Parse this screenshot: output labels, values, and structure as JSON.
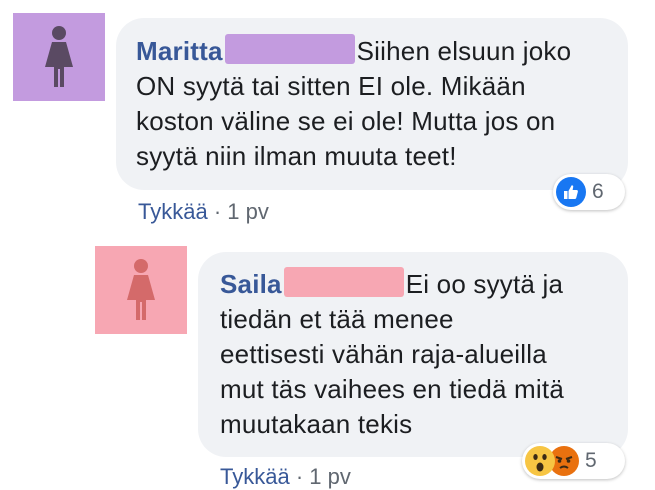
{
  "comments": [
    {
      "author": "Maritta",
      "text_lines": [
        "Siihen elsuun joko",
        "ON syytä tai sitten EI ole. Mikään",
        "koston väline se ei ole! Mutta jos on",
        "syytä niin ilman muuta teet!"
      ],
      "avatar_color": "#c39bdf",
      "avatar_figure_color": "#5a4a63",
      "redaction_color": "#c39bdf",
      "like_label": "Tykkää",
      "separator": "·",
      "time": "1 pv",
      "reactions": [
        "like-icon"
      ],
      "reaction_count": "6"
    },
    {
      "author": "Saila",
      "text_lines": [
        "Ei oo syytä ja",
        "tiedän et tää menee",
        "eettisesti vähän raja-alueilla",
        "mut täs vaihees en tiedä mitä",
        "muutakaan tekis"
      ],
      "avatar_color": "#f7a7b3",
      "avatar_figure_color": "#d46a6a",
      "redaction_color": "#f7a7b3",
      "like_label": "Tykkää",
      "separator": "·",
      "time": "1 pv",
      "reactions": [
        "wow-icon",
        "angry-icon"
      ],
      "reaction_count": "5"
    }
  ],
  "colors": {
    "bubble": "#f0f2f5",
    "author": "#385898",
    "like_blue": "#1877f2"
  }
}
